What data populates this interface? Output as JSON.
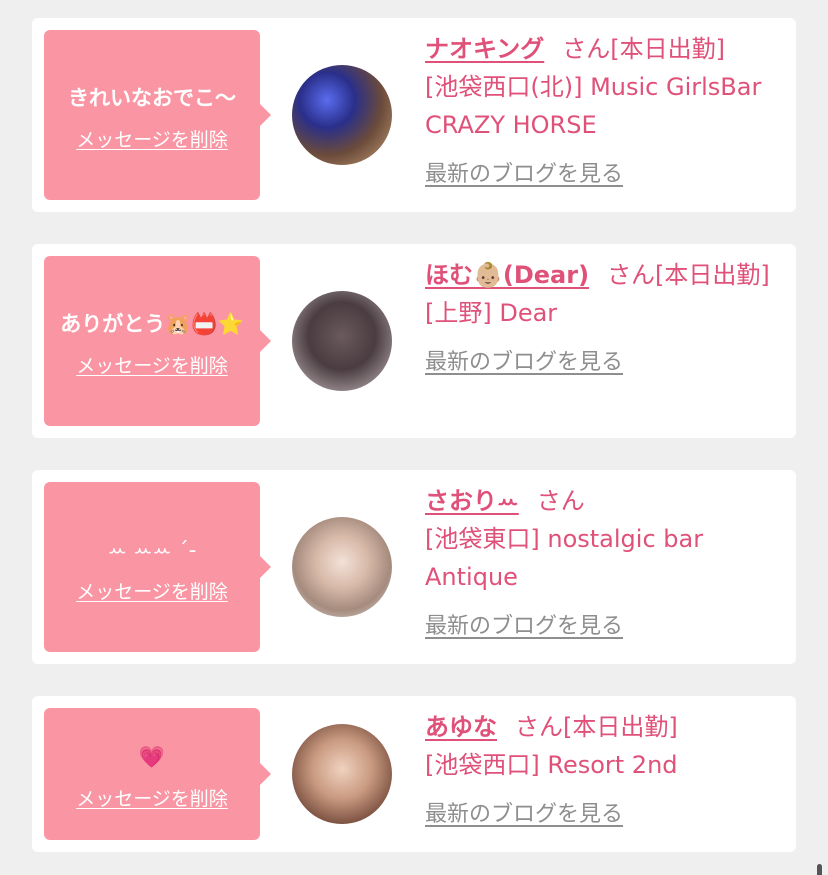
{
  "cards": [
    {
      "message": "きれいなおでこ〜",
      "delete_label": "メッセージを削除",
      "name": "ナオキング",
      "suffix": "さん[本日出勤]",
      "shop": "[池袋西口(北)] Music GirlsBar CRAZY HORSE",
      "blog_label": "最新のブログを見る"
    },
    {
      "message": "ありがとう🐹📛⭐",
      "delete_label": "メッセージを削除",
      "name": "ほむ👶🏼(Dear)",
      "suffix": "さん[本日出勤]",
      "shop": "[上野] Dear",
      "blog_label": "最新のブログを見る"
    },
    {
      "message": "ꕀ ꕀꕀ ˊ-",
      "delete_label": "メッセージを削除",
      "name": "さおりꕀ",
      "suffix": "さん",
      "shop": "[池袋東口] nostalgic bar Antique",
      "blog_label": "最新のブログを見る"
    },
    {
      "message": "💗",
      "delete_label": "メッセージを削除",
      "name": "あゆな",
      "suffix": "さん[本日出勤]",
      "shop": "[池袋西口] Resort 2nd",
      "blog_label": "最新のブログを見る"
    }
  ],
  "colors": {
    "bubble": "#fa96a4",
    "name": "#e0517a",
    "link_gray": "#8e8e8e",
    "background": "#efefef"
  }
}
